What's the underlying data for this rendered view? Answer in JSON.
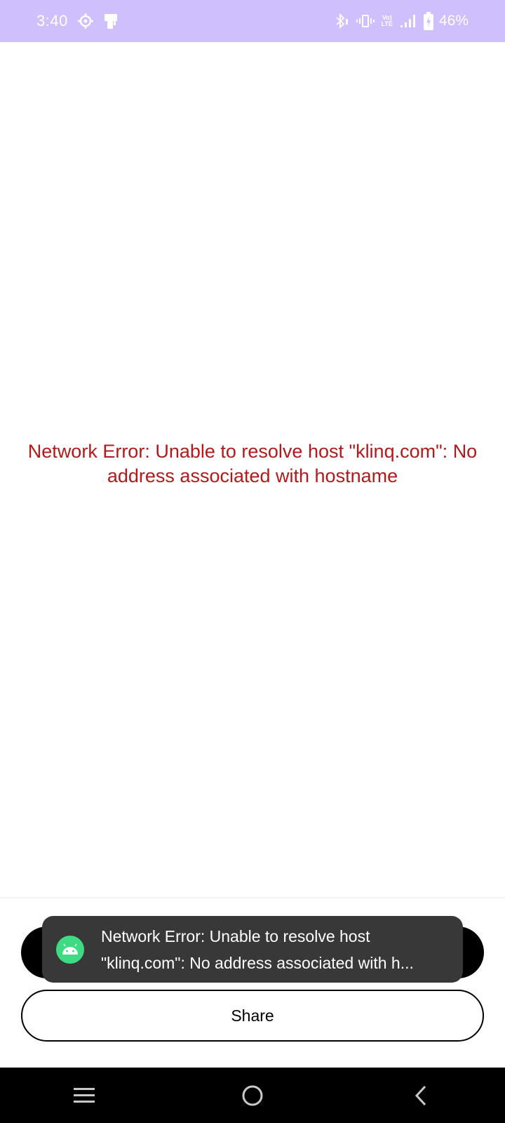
{
  "status_bar": {
    "time": "3:40",
    "battery_percent": "46%",
    "volte_line1": "Vo)",
    "volte_line2": "LTE",
    "icons": [
      "settings-gear-icon",
      "notification-app-icon",
      "bluetooth-icon",
      "vibrate-icon",
      "volte-icon",
      "signal-icon",
      "battery-charging-icon"
    ],
    "background_color": "#cfc0fd"
  },
  "main": {
    "error_message": "Network Error: Unable to resolve host \"klinq.com\": No address associated with hostname",
    "error_color": "#b3191b"
  },
  "actions": {
    "primary_label": "",
    "share_label": "Share"
  },
  "toast": {
    "line1": "Network Error: Unable to resolve host",
    "line2": "\"klinq.com\": No address associated with h...",
    "icon": "android-icon",
    "icon_color": "#3ddc84",
    "background_color": "#383838"
  },
  "nav_bar": {
    "buttons": [
      "recents-icon",
      "home-icon",
      "back-icon"
    ]
  }
}
